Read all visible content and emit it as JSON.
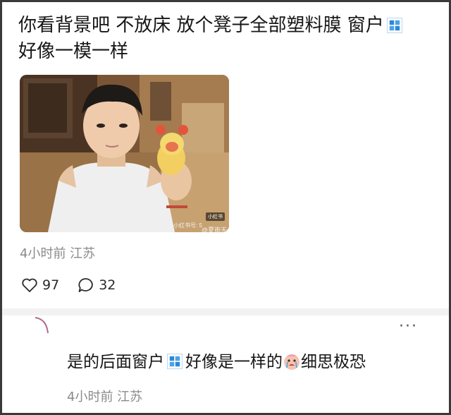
{
  "post": {
    "text_line1": "你看背景吧 不放床 放个凳子全部塑料膜 窗户",
    "text_line2": "好像一模一样",
    "icon_after_text": "window-icon",
    "image": {
      "description_icon": "photo",
      "watermark_badge": "小红书",
      "watermark_line": "小红书号: 5",
      "watermark_weibo": "@夏雨天"
    },
    "meta": "4小时前 江苏",
    "likes": "97",
    "comments": "32"
  },
  "reply": {
    "text_before_icon": "是的后面窗户",
    "icon": "window-icon",
    "text_middle": "好像是一样的",
    "emoji": "crying-face-emoji",
    "text_after_emoji": "细思极恐",
    "meta": "4小时前 江苏",
    "more_label": "···"
  },
  "colors": {
    "meta_gray": "#8a8a8a",
    "window_blue": "#2b88d8",
    "border": "#3a3a3a"
  }
}
